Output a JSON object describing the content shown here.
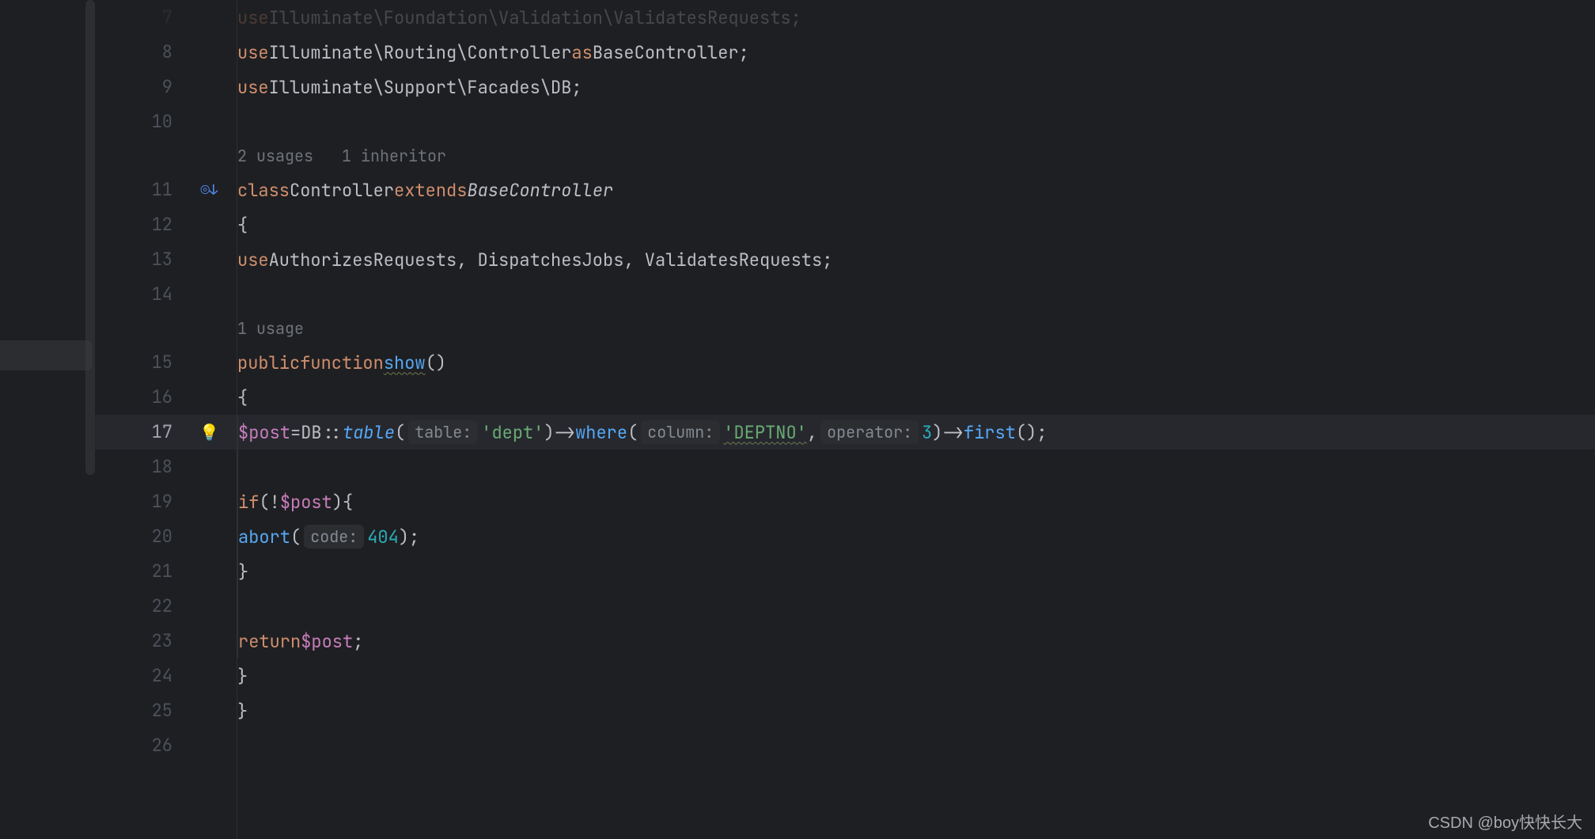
{
  "watermark": "CSDN @boy快快长大",
  "hints": {
    "class": "2 usages   1 inheritor",
    "method": "1 usage"
  },
  "icons": {
    "implements": "◎↓",
    "bulb": "💡"
  },
  "gutter": [
    "7",
    "8",
    "9",
    "10",
    "",
    "11",
    "12",
    "13",
    "14",
    "",
    "15",
    "16",
    "17",
    "18",
    "19",
    "20",
    "21",
    "22",
    "23",
    "24",
    "25",
    "26"
  ],
  "tokens": {
    "use": "use",
    "class": "class",
    "extends": "extends",
    "public": "public",
    "function": "function",
    "if": "if",
    "return": "return",
    "as": "as",
    "ns1": "Illuminate\\Routing\\Controller",
    "baseController": "BaseController",
    "ns2": "Illuminate\\Support\\Facades\\DB",
    "controller": "Controller",
    "traits": "AuthorizesRequests, DispatchesJobs, ValidatesRequests",
    "show": "show",
    "post": "$post",
    "DB": "DB",
    "table": "table",
    "where": "where",
    "first": "first",
    "abort": "abort",
    "tableHint": "table:",
    "columnHint": "column:",
    "operatorHint": "operator:",
    "codeHint": "code:",
    "deptStr": "'dept'",
    "deptnoStr": "'DEPTNO'",
    "three": "3",
    "fourOhFour": "404",
    "lbrace": "{",
    "rbrace": "}",
    "lparen": "(",
    "rparen": ")",
    "semi": ";",
    "arrow": "->",
    "dcolon": "::",
    "eq": "=",
    "bang": "!",
    "comma": ","
  }
}
